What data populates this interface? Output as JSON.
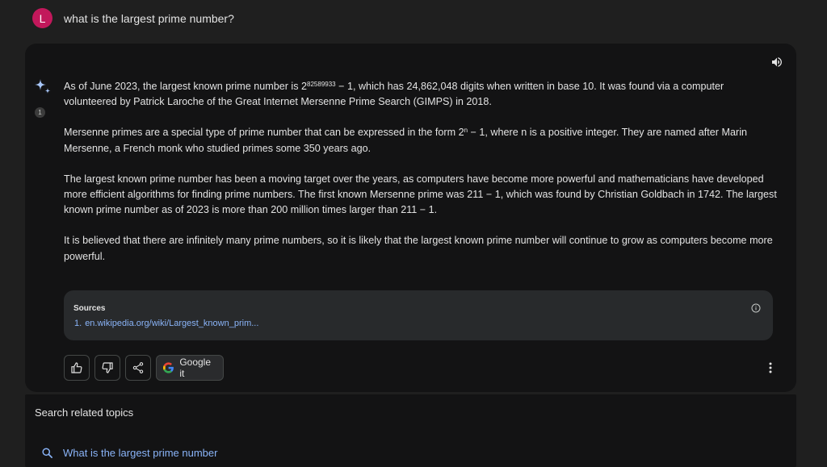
{
  "query": {
    "avatar_letter": "L",
    "text": "what is the largest prime number?"
  },
  "response": {
    "draft_number": "1",
    "paragraphs": {
      "p1_pre": "As of June 2023, the largest known prime number is 2",
      "p1_sup": "82589933",
      "p1_post": " − 1, which has 24,862,048 digits when written in base 10. It was found via a computer volunteered by Patrick Laroche of the Great Internet Mersenne Prime Search (GIMPS) in 2018.",
      "p2_pre": "Mersenne primes are a special type of prime number that can be expressed in the form 2",
      "p2_sup": "n",
      "p2_post": " − 1, where n is a positive integer. They are named after Marin Mersenne, a French monk who studied primes some 350 years ago.",
      "p3": "The largest known prime number has been a moving target over the years, as computers have become more powerful and mathematicians have developed more efficient algorithms for finding prime numbers. The first known Mersenne prime was 211 − 1, which was found by Christian Goldbach in 1742. The largest known prime number as of 2023 is more than 200 million times larger than 211 − 1.",
      "p4": "It is believed that there are infinitely many prime numbers, so it is likely that the largest known prime number will continue to grow as computers become more powerful."
    },
    "sources": {
      "title": "Sources",
      "items": [
        {
          "num": "1.",
          "link": "en.wikipedia.org/wiki/Largest_known_prim..."
        }
      ]
    },
    "actions": {
      "google_label": "Google it"
    }
  },
  "related": {
    "header": "Search related topics",
    "items": [
      {
        "label": "What is the largest prime number"
      }
    ]
  },
  "colors": {
    "background": "#1f1f1f",
    "card": "#131314",
    "avatar": "#c2185b",
    "link": "#8ab4f8"
  },
  "icons": [
    "speaker-icon",
    "sparkle-icon",
    "info-icon",
    "thumbs-up-icon",
    "thumbs-down-icon",
    "share-icon",
    "google-logo-icon",
    "more-vert-icon",
    "search-icon"
  ]
}
